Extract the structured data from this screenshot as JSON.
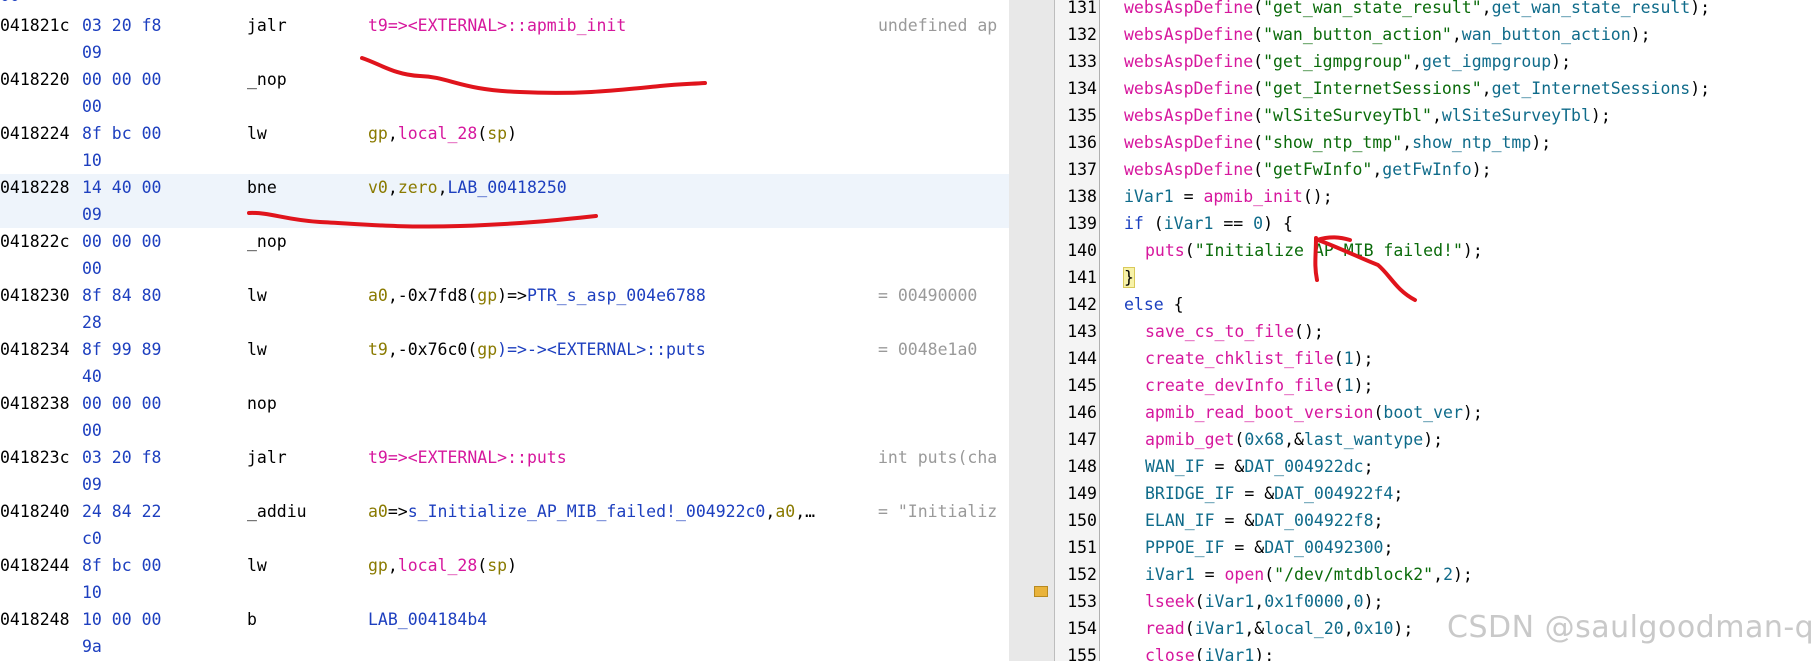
{
  "listing": {
    "top_clip": "00",
    "rows": [
      {
        "addr": "041821c",
        "bytes": "03 20 f8",
        "bytes2": "09",
        "mnem": "jalr",
        "ops": [
          {
            "t": "t9=><EXTERNAL>::apmib_init",
            "c": "mag"
          }
        ],
        "comment": "undefined ap"
      },
      {
        "addr": "0418220",
        "bytes": "00 00 00",
        "bytes2": "00",
        "mnem": "_nop",
        "ops": [],
        "comment": ""
      },
      {
        "addr": "0418224",
        "bytes": "8f bc 00",
        "bytes2": "10",
        "mnem": "lw",
        "ops": [
          {
            "t": "gp",
            "c": "olive"
          },
          {
            "t": ",",
            "c": "dark"
          },
          {
            "t": "local_28",
            "c": "mag"
          },
          {
            "t": "(",
            "c": "dark"
          },
          {
            "t": "sp",
            "c": "olive"
          },
          {
            "t": ")",
            "c": "dark"
          }
        ],
        "comment": ""
      },
      {
        "addr": "0418228",
        "bytes": "14 40 00",
        "bytes2": "09",
        "mnem": "bne",
        "ops": [
          {
            "t": "v0",
            "c": "olive"
          },
          {
            "t": ",",
            "c": "dark"
          },
          {
            "t": "zero",
            "c": "olive"
          },
          {
            "t": ",",
            "c": "dark"
          },
          {
            "t": "LAB_00418250",
            "c": "blue"
          }
        ],
        "comment": "",
        "highlight": true
      },
      {
        "addr": "041822c",
        "bytes": "00 00 00",
        "bytes2": "00",
        "mnem": "_nop",
        "ops": [],
        "comment": ""
      },
      {
        "addr": "0418230",
        "bytes": "8f 84 80",
        "bytes2": "28",
        "mnem": "lw",
        "ops": [
          {
            "t": "a0",
            "c": "olive"
          },
          {
            "t": ",-0x7fd8(",
            "c": "dark"
          },
          {
            "t": "gp",
            "c": "olive"
          },
          {
            "t": ")=>",
            "c": "dark"
          },
          {
            "t": "PTR_s_asp_004e6788",
            "c": "blue"
          }
        ],
        "comment": "= 00490000"
      },
      {
        "addr": "0418234",
        "bytes": "8f 99 89",
        "bytes2": "40",
        "mnem": "lw",
        "ops": [
          {
            "t": "t9",
            "c": "olive"
          },
          {
            "t": ",-0x76c0(",
            "c": "dark"
          },
          {
            "t": "gp",
            "c": "olive"
          },
          {
            "t": ")=>-><EXTERNAL>::puts",
            "c": "blue"
          }
        ],
        "comment": "= 0048e1a0"
      },
      {
        "addr": "0418238",
        "bytes": "00 00 00",
        "bytes2": "00",
        "mnem": "nop",
        "ops": [],
        "comment": ""
      },
      {
        "addr": "041823c",
        "bytes": "03 20 f8",
        "bytes2": "09",
        "mnem": "jalr",
        "ops": [
          {
            "t": "t9=><EXTERNAL>::puts",
            "c": "mag"
          }
        ],
        "comment": "int puts(cha"
      },
      {
        "addr": "0418240",
        "bytes": "24 84 22",
        "bytes2": "c0",
        "mnem": "_addiu",
        "ops": [
          {
            "t": "a0",
            "c": "olive"
          },
          {
            "t": "=>",
            "c": "dark"
          },
          {
            "t": "s_Initialize_AP_MIB_failed!_004922c0",
            "c": "blue"
          },
          {
            "t": ",",
            "c": "dark"
          },
          {
            "t": "a0",
            "c": "olive"
          },
          {
            "t": ",…",
            "c": "dark"
          }
        ],
        "comment": "= \"Initializ"
      },
      {
        "addr": "0418244",
        "bytes": "8f bc 00",
        "bytes2": "10",
        "mnem": "lw",
        "ops": [
          {
            "t": "gp",
            "c": "olive"
          },
          {
            "t": ",",
            "c": "dark"
          },
          {
            "t": "local_28",
            "c": "mag"
          },
          {
            "t": "(",
            "c": "dark"
          },
          {
            "t": "sp",
            "c": "olive"
          },
          {
            "t": ")",
            "c": "dark"
          }
        ],
        "comment": ""
      },
      {
        "addr": "0418248",
        "bytes": "10 00 00",
        "bytes2": "9a",
        "mnem": "b",
        "ops": [
          {
            "t": "LAB_004184b4",
            "c": "blue"
          }
        ],
        "comment": ""
      }
    ]
  },
  "decompiler": {
    "lines": [
      {
        "n": "131",
        "indent": 0,
        "parts": [
          {
            "t": "websAspDefine",
            "c": "fn"
          },
          {
            "t": "(",
            "c": "p"
          },
          {
            "t": "\"get_wan_state_result\"",
            "c": "str"
          },
          {
            "t": ",",
            "c": "p"
          },
          {
            "t": "get_wan_state_result",
            "c": "var"
          },
          {
            "t": ");",
            "c": "p"
          }
        ]
      },
      {
        "n": "132",
        "indent": 0,
        "parts": [
          {
            "t": "websAspDefine",
            "c": "fn"
          },
          {
            "t": "(",
            "c": "p"
          },
          {
            "t": "\"wan_button_action\"",
            "c": "str"
          },
          {
            "t": ",",
            "c": "p"
          },
          {
            "t": "wan_button_action",
            "c": "var"
          },
          {
            "t": ");",
            "c": "p"
          }
        ]
      },
      {
        "n": "133",
        "indent": 0,
        "parts": [
          {
            "t": "websAspDefine",
            "c": "fn"
          },
          {
            "t": "(",
            "c": "p"
          },
          {
            "t": "\"get_igmpgroup\"",
            "c": "str"
          },
          {
            "t": ",",
            "c": "p"
          },
          {
            "t": "get_igmpgroup",
            "c": "var"
          },
          {
            "t": ");",
            "c": "p"
          }
        ]
      },
      {
        "n": "134",
        "indent": 0,
        "parts": [
          {
            "t": "websAspDefine",
            "c": "fn"
          },
          {
            "t": "(",
            "c": "p"
          },
          {
            "t": "\"get_InternetSessions\"",
            "c": "str"
          },
          {
            "t": ",",
            "c": "p"
          },
          {
            "t": "get_InternetSessions",
            "c": "var"
          },
          {
            "t": ");",
            "c": "p"
          }
        ]
      },
      {
        "n": "135",
        "indent": 0,
        "parts": [
          {
            "t": "websAspDefine",
            "c": "fn"
          },
          {
            "t": "(",
            "c": "p"
          },
          {
            "t": "\"wlSiteSurveyTbl\"",
            "c": "str"
          },
          {
            "t": ",",
            "c": "p"
          },
          {
            "t": "wlSiteSurveyTbl",
            "c": "var"
          },
          {
            "t": ");",
            "c": "p"
          }
        ]
      },
      {
        "n": "136",
        "indent": 0,
        "parts": [
          {
            "t": "websAspDefine",
            "c": "fn"
          },
          {
            "t": "(",
            "c": "p"
          },
          {
            "t": "\"show_ntp_tmp\"",
            "c": "str"
          },
          {
            "t": ",",
            "c": "p"
          },
          {
            "t": "show_ntp_tmp",
            "c": "var"
          },
          {
            "t": ");",
            "c": "p"
          }
        ]
      },
      {
        "n": "137",
        "indent": 0,
        "parts": [
          {
            "t": "websAspDefine",
            "c": "fn"
          },
          {
            "t": "(",
            "c": "p"
          },
          {
            "t": "\"getFwInfo\"",
            "c": "str"
          },
          {
            "t": ",",
            "c": "p"
          },
          {
            "t": "getFwInfo",
            "c": "var"
          },
          {
            "t": ");",
            "c": "p"
          }
        ]
      },
      {
        "n": "138",
        "indent": 0,
        "parts": [
          {
            "t": "iVar1",
            "c": "var"
          },
          {
            "t": " = ",
            "c": "p"
          },
          {
            "t": "apmib_init",
            "c": "fn"
          },
          {
            "t": "();",
            "c": "p"
          }
        ]
      },
      {
        "n": "139",
        "indent": 0,
        "parts": [
          {
            "t": "if",
            "c": "kw"
          },
          {
            "t": " (",
            "c": "p"
          },
          {
            "t": "iVar1",
            "c": "var"
          },
          {
            "t": " == ",
            "c": "p"
          },
          {
            "t": "0",
            "c": "num"
          },
          {
            "t": ") {",
            "c": "p"
          }
        ]
      },
      {
        "n": "140",
        "indent": 1,
        "parts": [
          {
            "t": "puts",
            "c": "fn"
          },
          {
            "t": "(",
            "c": "p"
          },
          {
            "t": "\"Initialize AP MIB failed!\"",
            "c": "str"
          },
          {
            "t": ");",
            "c": "p"
          }
        ]
      },
      {
        "n": "141",
        "indent": 0,
        "parts": [
          {
            "t": "}",
            "c": "brace"
          }
        ]
      },
      {
        "n": "142",
        "indent": 0,
        "parts": [
          {
            "t": "else",
            "c": "kw"
          },
          {
            "t": " {",
            "c": "p"
          }
        ]
      },
      {
        "n": "143",
        "indent": 1,
        "parts": [
          {
            "t": "save_cs_to_file",
            "c": "fn"
          },
          {
            "t": "();",
            "c": "p"
          }
        ]
      },
      {
        "n": "144",
        "indent": 1,
        "parts": [
          {
            "t": "create_chklist_file",
            "c": "fn"
          },
          {
            "t": "(",
            "c": "p"
          },
          {
            "t": "1",
            "c": "num"
          },
          {
            "t": ");",
            "c": "p"
          }
        ]
      },
      {
        "n": "145",
        "indent": 1,
        "parts": [
          {
            "t": "create_devInfo_file",
            "c": "fn"
          },
          {
            "t": "(",
            "c": "p"
          },
          {
            "t": "1",
            "c": "num"
          },
          {
            "t": ");",
            "c": "p"
          }
        ]
      },
      {
        "n": "146",
        "indent": 1,
        "parts": [
          {
            "t": "apmib_read_boot_version",
            "c": "fn"
          },
          {
            "t": "(",
            "c": "p"
          },
          {
            "t": "boot_ver",
            "c": "var"
          },
          {
            "t": ");",
            "c": "p"
          }
        ]
      },
      {
        "n": "147",
        "indent": 1,
        "parts": [
          {
            "t": "apmib_get",
            "c": "fn"
          },
          {
            "t": "(",
            "c": "p"
          },
          {
            "t": "0x68",
            "c": "num"
          },
          {
            "t": ",&",
            "c": "p"
          },
          {
            "t": "last_wantype",
            "c": "var"
          },
          {
            "t": ");",
            "c": "p"
          }
        ]
      },
      {
        "n": "148",
        "indent": 1,
        "parts": [
          {
            "t": "WAN_IF",
            "c": "var"
          },
          {
            "t": " = &",
            "c": "p"
          },
          {
            "t": "DAT_004922dc",
            "c": "var"
          },
          {
            "t": ";",
            "c": "p"
          }
        ]
      },
      {
        "n": "149",
        "indent": 1,
        "parts": [
          {
            "t": "BRIDGE_IF",
            "c": "var"
          },
          {
            "t": " = &",
            "c": "p"
          },
          {
            "t": "DAT_004922f4",
            "c": "var"
          },
          {
            "t": ";",
            "c": "p"
          }
        ]
      },
      {
        "n": "150",
        "indent": 1,
        "parts": [
          {
            "t": "ELAN_IF",
            "c": "var"
          },
          {
            "t": " = &",
            "c": "p"
          },
          {
            "t": "DAT_004922f8",
            "c": "var"
          },
          {
            "t": ";",
            "c": "p"
          }
        ]
      },
      {
        "n": "151",
        "indent": 1,
        "parts": [
          {
            "t": "PPPOE_IF",
            "c": "var"
          },
          {
            "t": " = &",
            "c": "p"
          },
          {
            "t": "DAT_00492300",
            "c": "var"
          },
          {
            "t": ";",
            "c": "p"
          }
        ]
      },
      {
        "n": "152",
        "indent": 1,
        "parts": [
          {
            "t": "iVar1",
            "c": "var"
          },
          {
            "t": " = ",
            "c": "p"
          },
          {
            "t": "open",
            "c": "fn"
          },
          {
            "t": "(",
            "c": "p"
          },
          {
            "t": "\"/dev/mtdblock2\"",
            "c": "str"
          },
          {
            "t": ",",
            "c": "p"
          },
          {
            "t": "2",
            "c": "num"
          },
          {
            "t": ");",
            "c": "p"
          }
        ]
      },
      {
        "n": "153",
        "indent": 1,
        "parts": [
          {
            "t": "lseek",
            "c": "fn"
          },
          {
            "t": "(",
            "c": "p"
          },
          {
            "t": "iVar1",
            "c": "var"
          },
          {
            "t": ",",
            "c": "p"
          },
          {
            "t": "0x1f0000",
            "c": "num"
          },
          {
            "t": ",",
            "c": "p"
          },
          {
            "t": "0",
            "c": "num"
          },
          {
            "t": ");",
            "c": "p"
          }
        ]
      },
      {
        "n": "154",
        "indent": 1,
        "parts": [
          {
            "t": "read",
            "c": "fn"
          },
          {
            "t": "(",
            "c": "p"
          },
          {
            "t": "iVar1",
            "c": "var"
          },
          {
            "t": ",&",
            "c": "p"
          },
          {
            "t": "local_20",
            "c": "var"
          },
          {
            "t": ",",
            "c": "p"
          },
          {
            "t": "0x10",
            "c": "num"
          },
          {
            "t": ");",
            "c": "p"
          }
        ]
      },
      {
        "n": "155",
        "indent": 1,
        "parts": [
          {
            "t": "close",
            "c": "fn"
          },
          {
            "t": "(",
            "c": "p"
          },
          {
            "t": "iVar1",
            "c": "var"
          },
          {
            "t": ");",
            "c": "p"
          }
        ]
      }
    ]
  },
  "watermark": "CSDN @saulgoodman-q",
  "colors": {
    "annotation": "#e0141c",
    "function": "#d6179d",
    "string": "#0a6b0a",
    "variable": "#0f6b8a",
    "keyword": "#1a3fbf"
  }
}
